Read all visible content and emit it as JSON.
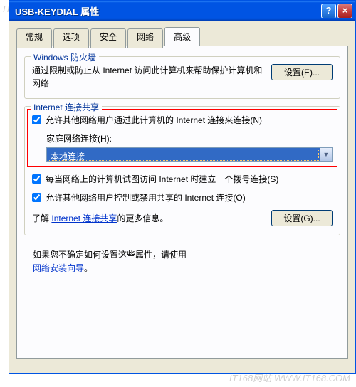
{
  "watermark": "IT168网站 WWW.IT168.COM",
  "titlebar": {
    "text": "USB-KEYDIAL 属性",
    "help": "?",
    "close": "×"
  },
  "tabs": [
    "常规",
    "选项",
    "安全",
    "网络",
    "高级"
  ],
  "active_tab": 4,
  "firewall": {
    "title": "Windows 防火墙",
    "text": "通过限制或防止从 Internet 访问此计算机来帮助保护计算机和网络",
    "button": "设置(E)..."
  },
  "ics": {
    "title": "Internet 连接共享",
    "check_allow": "允许其他网络用户通过此计算机的 Internet 连接来连接(N)",
    "home_label": "家庭网络连接(H):",
    "home_value": "本地连接",
    "check_dial": "每当网络上的计算机试图访问 Internet 时建立一个拨号连接(S)",
    "check_control": "允许其他网络用户控制或禁用共享的 Internet 连接(O)",
    "learn_text": "了解",
    "learn_link": "Internet 连接共享",
    "learn_suffix": "的更多信息。",
    "settings_btn": "设置(G)..."
  },
  "bottom": {
    "line1": "如果您不确定如何设置这些属性，请使用",
    "wizard_link": "网络安装向导",
    "period": "。"
  }
}
